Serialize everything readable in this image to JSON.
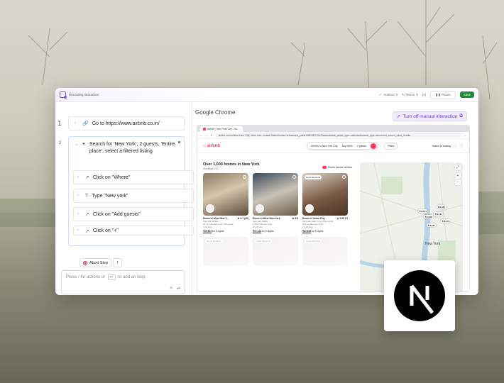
{
  "topbar": {
    "title": "Recording interaction",
    "autorun": "Autorun",
    "autorun_count": "0",
    "rerun": "Rerun",
    "rerun_count": "0",
    "var_label": "{x}",
    "pause_label": "Pause",
    "save_label": "Save"
  },
  "steps": [
    {
      "index": "1",
      "text": "Go to https://www.airbnb.co.in/"
    },
    {
      "index": "2",
      "text": "Search for 'New York', 2 guests, 'Entire place', select a filtered listing",
      "substeps": [
        {
          "text": "Click on \"Where\""
        },
        {
          "text": "Type \"New york\""
        },
        {
          "text": "Click on \"Add guests\""
        },
        {
          "text": "Click on \"+\""
        }
      ]
    }
  ],
  "abort_label": "Abort Step",
  "prompt": {
    "text_before": "Press / for actions or",
    "key": "↵",
    "text_after": "to add an step"
  },
  "main": {
    "chrome_label": "Google Chrome",
    "turn_off_label": "Turn off manual interaction"
  },
  "browser": {
    "tab_title": "Airbnb | New York City - Ho...",
    "url": "airbnb.co.in/s/New-York--City--New-York--United-States/homes?refinement_paths%5B%5D=%2Fhomes&date_picker_type=calendar&search_type=structured_search_input_header"
  },
  "airbnb": {
    "logo": "airbnb",
    "search_where": "Homes in New York City",
    "search_when": "Any week",
    "search_who": "2 guests",
    "filters": "Filters",
    "switch_hosting": "Switch to hosting",
    "heading": "Over 1,000 homes in New York",
    "showing": "Showing 1-18",
    "prices_note": "Prices include all fees",
    "listings": [
      {
        "title": "Room in West New Y...",
        "rating": "★ 4.7 (43)",
        "line1": "Stay with Widler",
        "line2": "30 very friendly room with views",
        "line3": "4–11 Feb",
        "price": "₹29,604",
        "price_suffix": "for 5 nights",
        "badge": ""
      },
      {
        "title": "Room in West New York",
        "rating": "★ 4.8",
        "line1": "Stay with Widler",
        "line2": "2,300 bedroom view",
        "line3": "15–20 Jan",
        "price": "₹27,125",
        "price_suffix": "for 5 nights",
        "badge": ""
      },
      {
        "title": "Room in Union City",
        "rating": "★ 4.90 (7)",
        "line1": "Stay with Marly in a vibrant artist",
        "line2": "City private room with",
        "line3": "15–20 Dec",
        "price": "₹42,535",
        "price_suffix": "for 5 nights",
        "badge": "Guest favourite"
      }
    ],
    "more_badges": [
      "Guest favourite",
      "Guest favourite",
      "Guest favourite"
    ],
    "map_label": "New York",
    "map_prices": [
      "₹18,874",
      "₹19,461",
      "₹14,853",
      "₹22,131",
      "₹18,470",
      "₹16,321"
    ]
  },
  "colors": {
    "accent": "#7c5cd6",
    "airbnb": "#ff385c",
    "save": "#1f8a3a"
  }
}
